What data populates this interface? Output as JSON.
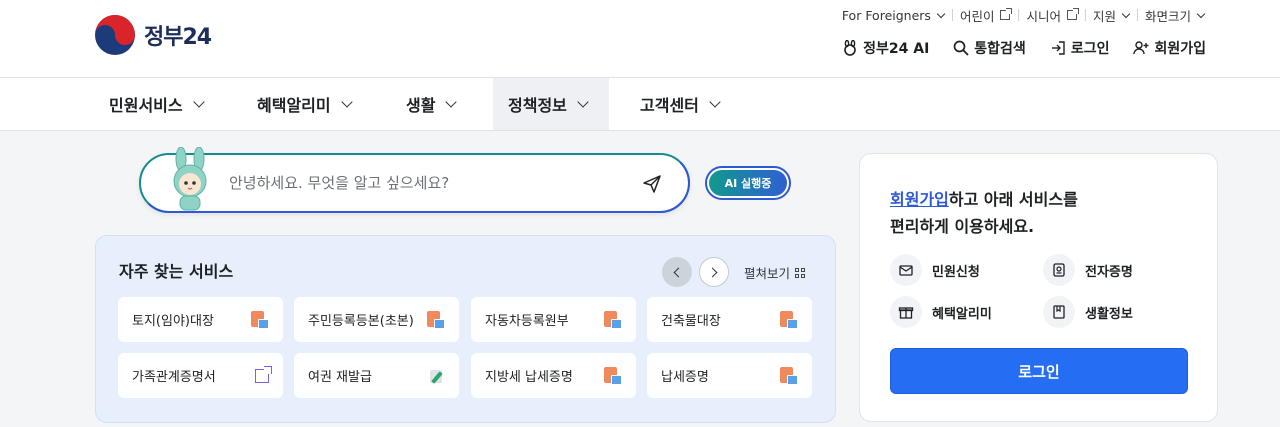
{
  "header": {
    "logo_text": "정부24",
    "utility": [
      {
        "label": "For Foreigners",
        "kind": "dropdown"
      },
      {
        "label": "어린이",
        "kind": "external"
      },
      {
        "label": "시니어",
        "kind": "external"
      },
      {
        "label": "지원",
        "kind": "dropdown"
      },
      {
        "label": "화면크기",
        "kind": "dropdown"
      }
    ],
    "actions": {
      "ai": "정부24 AI",
      "search": "통합검색",
      "login": "로그인",
      "signup": "회원가입"
    }
  },
  "nav": {
    "items": [
      {
        "label": "민원서비스"
      },
      {
        "label": "혜택알리미"
      },
      {
        "label": "생활"
      },
      {
        "label": "정책정보",
        "active": true
      },
      {
        "label": "고객센터"
      }
    ]
  },
  "search": {
    "placeholder": "안녕하세요. 무엇을 알고 싶으세요?",
    "ai_badge": "AI 실행중"
  },
  "frequent": {
    "title": "자주 찾는 서비스",
    "expand_label": "펼쳐보기",
    "items": [
      {
        "label": "토지(임야)대장",
        "icon": "document-icon"
      },
      {
        "label": "주민등록등본(초본)",
        "icon": "document-icon"
      },
      {
        "label": "자동차등록원부",
        "icon": "document-icon"
      },
      {
        "label": "건축물대장",
        "icon": "document-icon"
      },
      {
        "label": "가족관계증명서",
        "icon": "external-link-icon"
      },
      {
        "label": "여권 재발급",
        "icon": "pen-icon"
      },
      {
        "label": "지방세 납세증명",
        "icon": "document-icon"
      },
      {
        "label": "납세증명",
        "icon": "document-icon"
      }
    ]
  },
  "card": {
    "message_link": "회원가입",
    "message_rest1": "하고 아래 서비스를",
    "message_line2": "편리하게 이용하세요.",
    "features": [
      {
        "label": "민원신청",
        "icon": "mail-icon"
      },
      {
        "label": "전자증명",
        "icon": "certificate-icon"
      },
      {
        "label": "혜택알리미",
        "icon": "gift-icon"
      },
      {
        "label": "생활정보",
        "icon": "book-icon"
      }
    ],
    "login_button": "로그인"
  },
  "colors": {
    "brand_blue": "#256ef4",
    "teal": "#1b8a8f",
    "frequent_bg": "#e6effb"
  }
}
